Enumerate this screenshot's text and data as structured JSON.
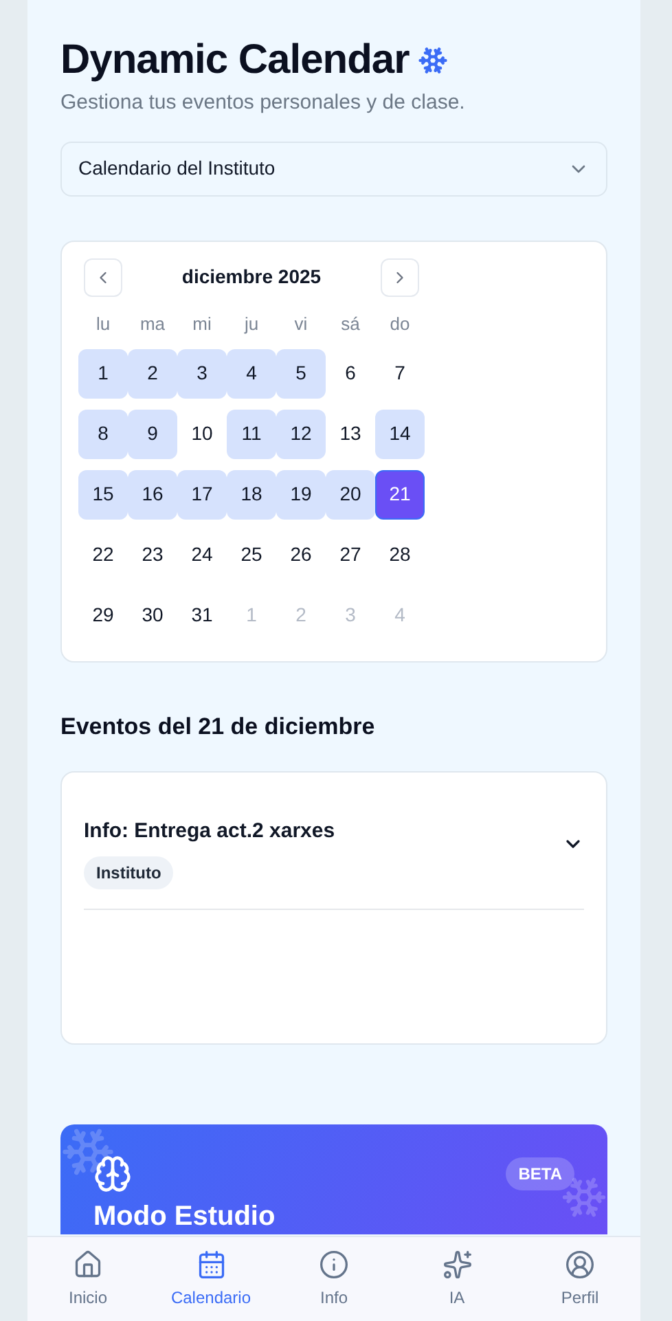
{
  "header": {
    "title": "Dynamic Calendar",
    "subtitle": "Gestiona tus eventos personales y de clase."
  },
  "calendar_select": {
    "value": "Calendario del Instituto"
  },
  "calendar": {
    "month": "diciembre 2025",
    "weekdays": [
      "lu",
      "ma",
      "mi",
      "ju",
      "vi",
      "sá",
      "do"
    ],
    "weeks": [
      [
        {
          "day": "1",
          "has_events": true,
          "selected": false,
          "outside": false
        },
        {
          "day": "2",
          "has_events": true,
          "selected": false,
          "outside": false
        },
        {
          "day": "3",
          "has_events": true,
          "selected": false,
          "outside": false
        },
        {
          "day": "4",
          "has_events": true,
          "selected": false,
          "outside": false
        },
        {
          "day": "5",
          "has_events": true,
          "selected": false,
          "outside": false
        },
        {
          "day": "6",
          "has_events": false,
          "selected": false,
          "outside": false
        },
        {
          "day": "7",
          "has_events": false,
          "selected": false,
          "outside": false
        }
      ],
      [
        {
          "day": "8",
          "has_events": true,
          "selected": false,
          "outside": false
        },
        {
          "day": "9",
          "has_events": true,
          "selected": false,
          "outside": false
        },
        {
          "day": "10",
          "has_events": false,
          "selected": false,
          "outside": false
        },
        {
          "day": "11",
          "has_events": true,
          "selected": false,
          "outside": false
        },
        {
          "day": "12",
          "has_events": true,
          "selected": false,
          "outside": false
        },
        {
          "day": "13",
          "has_events": false,
          "selected": false,
          "outside": false
        },
        {
          "day": "14",
          "has_events": true,
          "selected": false,
          "outside": false
        }
      ],
      [
        {
          "day": "15",
          "has_events": true,
          "selected": false,
          "outside": false
        },
        {
          "day": "16",
          "has_events": true,
          "selected": false,
          "outside": false
        },
        {
          "day": "17",
          "has_events": true,
          "selected": false,
          "outside": false
        },
        {
          "day": "18",
          "has_events": true,
          "selected": false,
          "outside": false
        },
        {
          "day": "19",
          "has_events": true,
          "selected": false,
          "outside": false
        },
        {
          "day": "20",
          "has_events": true,
          "selected": false,
          "outside": false
        },
        {
          "day": "21",
          "has_events": true,
          "selected": true,
          "outside": false
        }
      ],
      [
        {
          "day": "22",
          "has_events": false,
          "selected": false,
          "outside": false
        },
        {
          "day": "23",
          "has_events": false,
          "selected": false,
          "outside": false
        },
        {
          "day": "24",
          "has_events": false,
          "selected": false,
          "outside": false
        },
        {
          "day": "25",
          "has_events": false,
          "selected": false,
          "outside": false
        },
        {
          "day": "26",
          "has_events": false,
          "selected": false,
          "outside": false
        },
        {
          "day": "27",
          "has_events": false,
          "selected": false,
          "outside": false
        },
        {
          "day": "28",
          "has_events": false,
          "selected": false,
          "outside": false
        }
      ],
      [
        {
          "day": "29",
          "has_events": false,
          "selected": false,
          "outside": false
        },
        {
          "day": "30",
          "has_events": false,
          "selected": false,
          "outside": false
        },
        {
          "day": "31",
          "has_events": false,
          "selected": false,
          "outside": false
        },
        {
          "day": "1",
          "has_events": false,
          "selected": false,
          "outside": true
        },
        {
          "day": "2",
          "has_events": false,
          "selected": false,
          "outside": true
        },
        {
          "day": "3",
          "has_events": false,
          "selected": false,
          "outside": true
        },
        {
          "day": "4",
          "has_events": false,
          "selected": false,
          "outside": true
        }
      ]
    ]
  },
  "events_heading": "Eventos del 21 de diciembre",
  "events": [
    {
      "title": "Info: Entrega act.2 xarxes",
      "tag": "Instituto",
      "expanded": false
    }
  ],
  "study_card": {
    "badge": "BETA",
    "title": "Modo Estudio"
  },
  "nav": [
    {
      "kind": "home",
      "label": "Inicio",
      "selected": false
    },
    {
      "kind": "calendar",
      "label": "Calendario",
      "selected": true
    },
    {
      "kind": "info",
      "label": "Info",
      "selected": false
    },
    {
      "kind": "ai",
      "label": "IA",
      "selected": false
    },
    {
      "kind": "profile",
      "label": "Perfil",
      "selected": false
    }
  ]
}
